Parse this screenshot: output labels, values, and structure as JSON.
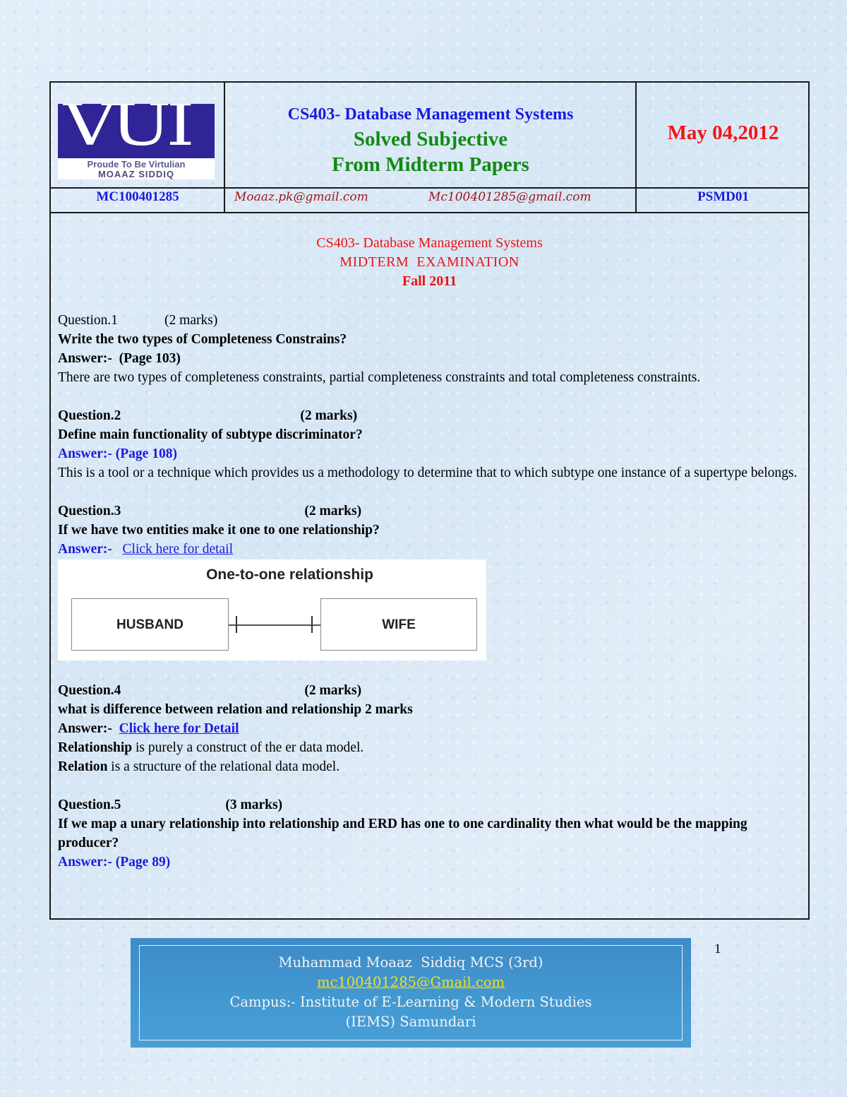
{
  "header": {
    "logo": {
      "mark": "VUI",
      "tagline": "Proude To Be Virtulian",
      "name": "MOAAZ SIDDIQ"
    },
    "course_title": "CS403- Database Management Systems",
    "subtitle_1": "Solved Subjective",
    "subtitle_2": "From Midterm Papers",
    "date": "May 04,2012",
    "student_id": "MC100401285",
    "email_1": "Moaaz.pk@gmail.com",
    "email_2": "Mc100401285@gmail.com",
    "code": "PSMD01"
  },
  "exam": {
    "course": "CS403- Database Management Systems",
    "type": "MIDTERM  EXAMINATION",
    "term": "Fall 2011"
  },
  "questions": [
    {
      "label": "Question.1",
      "marks": "(2 marks)",
      "text": "Write the two types of Completeness Constrains?",
      "answer_label": "Answer:-",
      "answer_ref": "(Page 103)",
      "answer_text": "There are two types of completeness constraints, partial completeness constraints and total completeness constraints."
    },
    {
      "label": "Question.2",
      "marks": "(2 marks)",
      "text": "Define main functionality of subtype discriminator?",
      "answer_label": "Answer:-",
      "answer_ref": "(Page 108)",
      "answer_text": "This is a tool or a technique which provides us a methodology to determine that to which subtype one instance of a supertype belongs."
    },
    {
      "label": "Question.3",
      "marks": "(2 marks)",
      "text": "If we have two entities make it one to one relationship?",
      "answer_label": "Answer:-",
      "answer_link": "Click here for detail",
      "diagram": {
        "title": "One-to-one relationship",
        "entity_left": "HUSBAND",
        "entity_right": "WIFE"
      }
    },
    {
      "label": "Question.4",
      "marks": "(2 marks)",
      "text": "what is difference between relation and relationship 2 marks",
      "answer_label": "Answer:-",
      "answer_link": "Click here for Detail",
      "answer_lines": [
        {
          "term": "Relationship",
          "rest": " is purely a construct of the er data model."
        },
        {
          "term": "Relation",
          "rest": " is a structure of the relational data model."
        }
      ]
    },
    {
      "label": "Question.5",
      "marks": "(3 marks)",
      "text": "If we map a unary relationship into relationship and ERD has one to one cardinality then what would be the mapping producer?",
      "answer_label": "Answer:-",
      "answer_ref": "(Page 89)"
    }
  ],
  "footer": {
    "author": "Muhammad Moaaz  Siddiq MCS (3rd)",
    "email": "mc100401285@Gmail.com",
    "campus_line1": "Campus:- Institute of E-Learning & Modern Studies",
    "campus_line2": "(IEMS) Samundari"
  },
  "page_number": "1",
  "colors": {
    "blue_text": "#1a1ae0",
    "green_text": "#128a12",
    "red_text": "#f01616",
    "email_text": "#a01818",
    "footer_bg": "#4399d2",
    "logo_bg": "#2f2596"
  }
}
